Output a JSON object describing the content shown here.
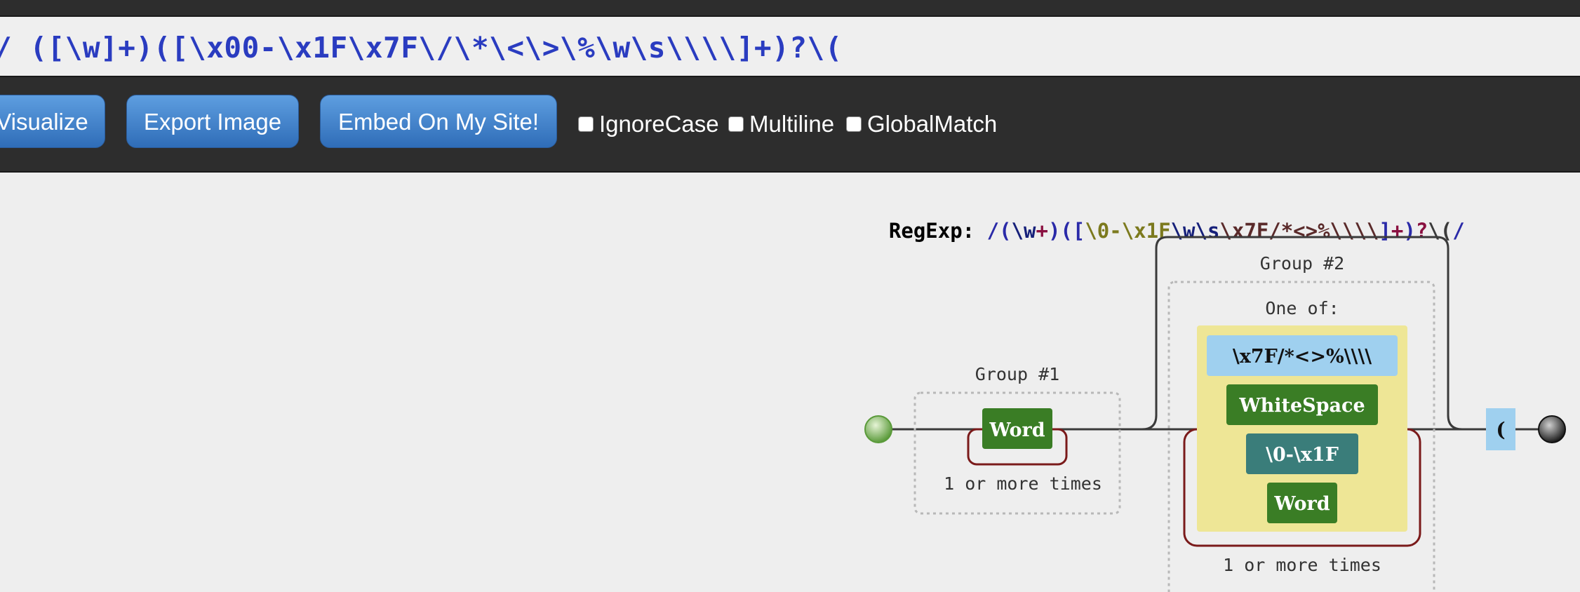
{
  "regex_input": {
    "text": "/ ([\\w]+)([\\x00-\\x1F\\x7F\\/\\*\\<\\>\\%\\w\\s\\\\\\\\]+)?\\("
  },
  "toolbar": {
    "visualize_label": "Visualize",
    "export_label": "Export Image",
    "embed_label": "Embed On My Site!",
    "ignorecase_label": "IgnoreCase",
    "multiline_label": "Multiline",
    "globalmatch_label": "GlobalMatch"
  },
  "regexp": {
    "label": "RegExp: ",
    "tokens": [
      {
        "text": "/",
        "color": "#2a2aa8"
      },
      {
        "text": "(",
        "color": "#2a2aa8"
      },
      {
        "text": "\\w",
        "color": "#16207a"
      },
      {
        "text": "+",
        "color": "#8a1040"
      },
      {
        "text": ")",
        "color": "#2a2aa8"
      },
      {
        "text": "(",
        "color": "#2a2aa8"
      },
      {
        "text": "[",
        "color": "#2a2aa8"
      },
      {
        "text": "\\0-\\x1F",
        "color": "#7c7a1e"
      },
      {
        "text": "\\w\\s",
        "color": "#16207a"
      },
      {
        "text": "\\x7F/*<>%\\\\\\\\",
        "color": "#5a2a2a"
      },
      {
        "text": "]",
        "color": "#2a2aa8"
      },
      {
        "text": "+",
        "color": "#8a1040"
      },
      {
        "text": ")",
        "color": "#2a2aa8"
      },
      {
        "text": "?",
        "color": "#8a1040"
      },
      {
        "text": "\\(",
        "color": "#3a3a3a"
      },
      {
        "text": "/",
        "color": "#2a2aa8"
      }
    ]
  },
  "diagram": {
    "group1_label": "Group #1",
    "group1_word": "Word",
    "group1_repeat": "1 or more times",
    "group2_label": "Group #2",
    "one_of_label": "One of:",
    "options": [
      "\\x7F/*<>%\\\\\\\\",
      "WhiteSpace",
      "\\0-\\x1F",
      "Word"
    ],
    "group2_repeat": "1 or more times",
    "literal": "(",
    "colors": {
      "word_green": "#3a7d25",
      "charset_yellow": "#eee696",
      "literal_blue": "#9fd0ef",
      "range_teal": "#3a7d7a",
      "loop_red": "#7a1a1a"
    }
  }
}
